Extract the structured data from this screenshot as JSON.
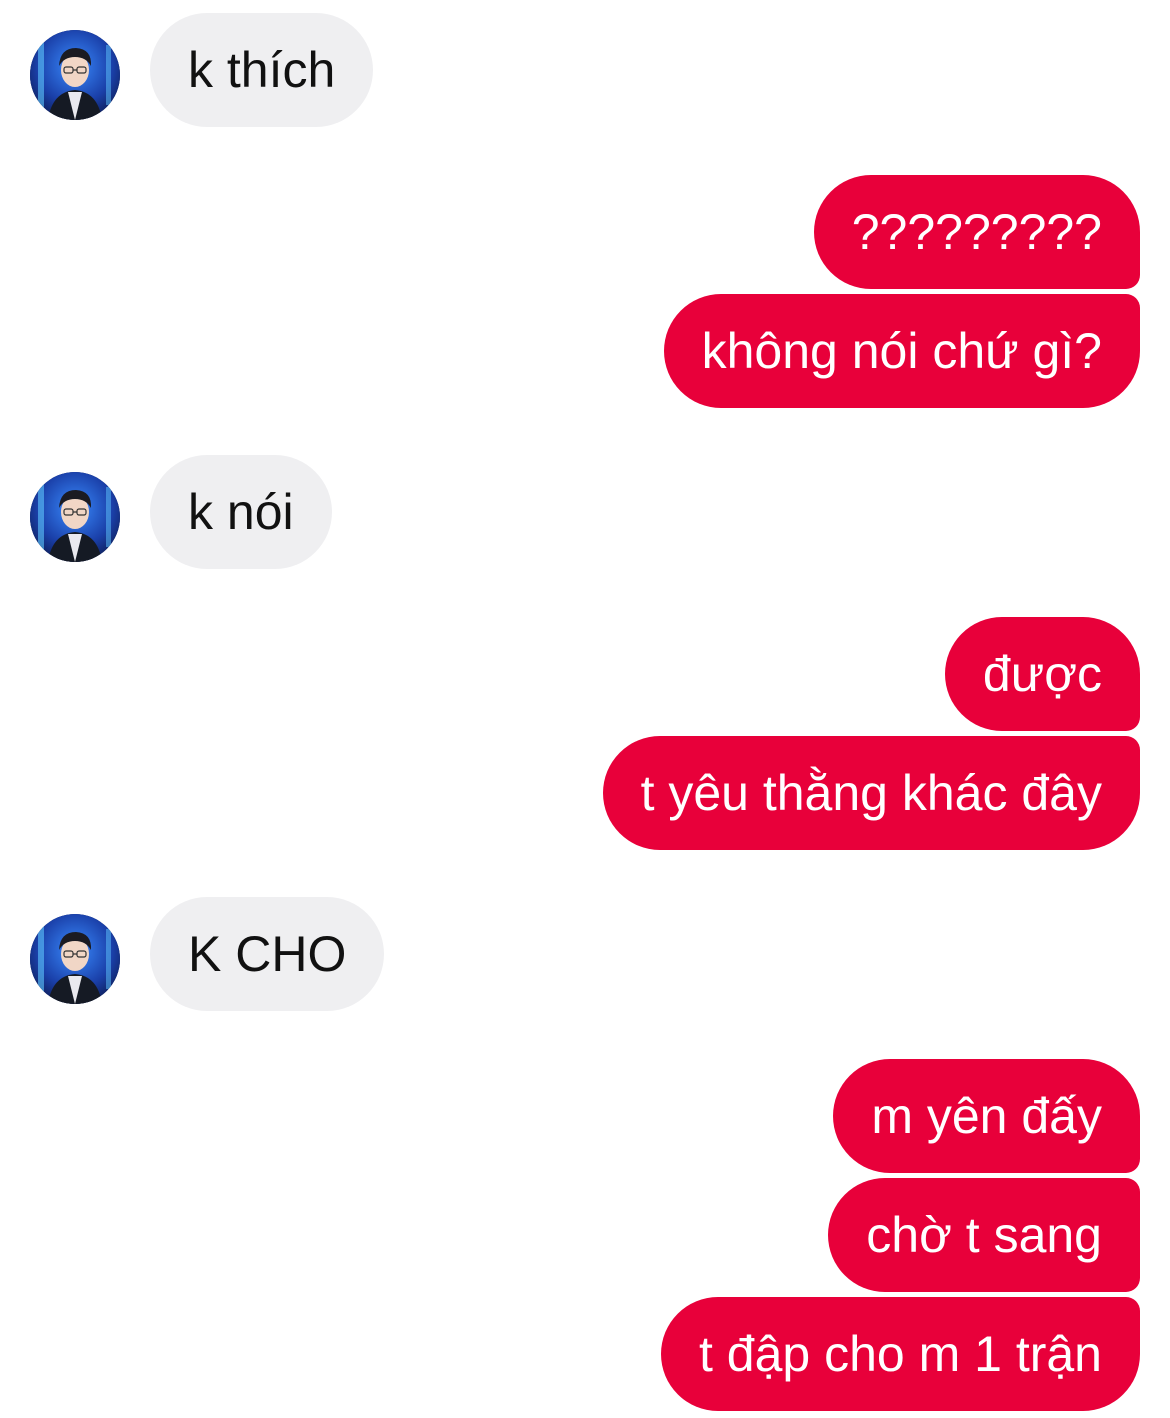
{
  "conversation": {
    "messages": [
      {
        "sender": "contact",
        "text": "k thích"
      },
      {
        "sender": "me",
        "text": "?????????"
      },
      {
        "sender": "me",
        "text": "không nói chứ gì?"
      },
      {
        "sender": "contact",
        "text": "k nói"
      },
      {
        "sender": "me",
        "text": "được"
      },
      {
        "sender": "me",
        "text": "t yêu thằng khác đây"
      },
      {
        "sender": "contact",
        "text": "K CHO"
      },
      {
        "sender": "me",
        "text": "m yên đấy"
      },
      {
        "sender": "me",
        "text": "chờ t sang"
      },
      {
        "sender": "me",
        "text": "t đập cho m 1 trận"
      }
    ]
  },
  "colors": {
    "outgoing_bubble": "#e8003a",
    "incoming_bubble": "#efeff1",
    "outgoing_text": "#ffffff",
    "incoming_text": "#111111",
    "background": "#ffffff"
  },
  "icons": {
    "contact_avatar": "profile-photo-avatar"
  }
}
